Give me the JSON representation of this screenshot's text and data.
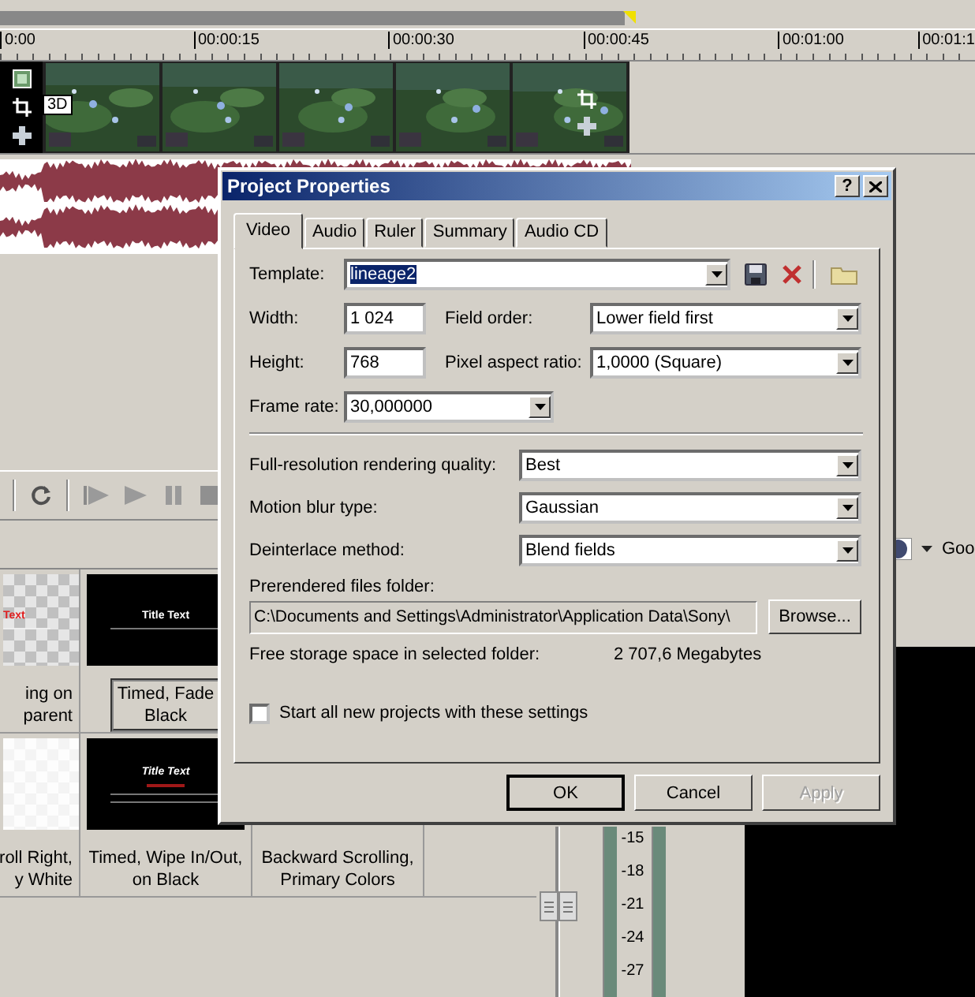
{
  "timeline": {
    "ruler_labels": [
      "0:00",
      "00:00:15",
      "00:00:30",
      "00:00:45",
      "00:01:00",
      "00:01:1"
    ],
    "clip_label": "3D"
  },
  "quality": {
    "value": "Goo"
  },
  "preset_rows": [
    [
      {
        "kind": "checker",
        "preview_text": "Text",
        "caption": [
          "ing on",
          "parent"
        ],
        "selected": false
      },
      {
        "kind": "dark",
        "preview_text": "Title Text",
        "caption": [
          "Timed, Fade",
          "Black"
        ],
        "selected": true
      }
    ],
    [
      {
        "kind": "light",
        "caption": [
          "roll Right,",
          "y White"
        ],
        "selected": false
      },
      {
        "kind": "dark-italic",
        "preview_text": "Title Text",
        "caption": [
          "Timed, Wipe In/Out,",
          "on Black"
        ],
        "selected": false
      },
      {
        "kind": "hidden",
        "caption": [
          "Backward Scrolling,",
          "Primary Colors"
        ],
        "selected": false
      }
    ]
  ],
  "meter_scale": [
    "-15",
    "-18",
    "-21",
    "-24",
    "-27"
  ],
  "dialog": {
    "title": "Project Properties",
    "help": "?",
    "tabs": [
      {
        "label": "Video",
        "selected": true
      },
      {
        "label": "Audio",
        "selected": false
      },
      {
        "label": "Ruler",
        "selected": false
      },
      {
        "label": "Summary",
        "selected": false
      },
      {
        "label": "Audio CD",
        "selected": false
      }
    ],
    "template": {
      "label": "Template:",
      "value": "lineage2",
      "text_selected": true
    },
    "width": {
      "label": "Width:",
      "value": "1 024"
    },
    "height": {
      "label": "Height:",
      "value": "768"
    },
    "field_order": {
      "label": "Field order:",
      "value": "Lower field first"
    },
    "pixel_aspect": {
      "label": "Pixel aspect ratio:",
      "value": "1,0000 (Square)"
    },
    "frame_rate": {
      "label": "Frame rate:",
      "value": "30,000000"
    },
    "options": [
      {
        "label": "Full-resolution rendering quality:",
        "value": "Best"
      },
      {
        "label": "Motion blur type:",
        "value": "Gaussian"
      },
      {
        "label": "Deinterlace method:",
        "value": "Blend fields"
      }
    ],
    "prerender": {
      "label": "Prerendered files folder:",
      "path": "C:\\Documents and Settings\\Administrator\\Application Data\\Sony\\",
      "browse": "Browse..."
    },
    "free_space": {
      "label": "Free storage space in selected folder:",
      "value": "2 707,6 Megabytes"
    },
    "start_all": {
      "label": "Start all new projects with these settings",
      "checked": false
    },
    "buttons": [
      {
        "label": "OK",
        "default": true,
        "disabled": false
      },
      {
        "label": "Cancel",
        "default": false,
        "disabled": false
      },
      {
        "label": "Apply",
        "default": false,
        "disabled": true
      }
    ]
  }
}
